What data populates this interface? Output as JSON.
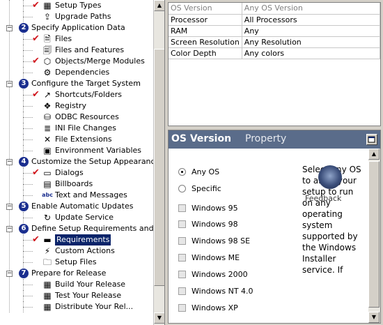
{
  "tree": {
    "items": [
      {
        "type": "leaf",
        "label": "Setup Types",
        "check": true,
        "icon": "setup-types-icon",
        "glyph": "▦"
      },
      {
        "type": "leaf",
        "label": "Upgrade Paths",
        "check": false,
        "icon": "upgrade-paths-icon",
        "glyph": "⇪"
      },
      {
        "type": "step",
        "num": "2",
        "label": "Specify Application Data"
      },
      {
        "type": "leaf",
        "label": "Files",
        "check": true,
        "icon": "files-icon",
        "glyph": "🗎"
      },
      {
        "type": "leaf",
        "label": "Files and Features",
        "check": false,
        "icon": "files-features-icon",
        "glyph": "🗐"
      },
      {
        "type": "leaf",
        "label": "Objects/Merge Modules",
        "check": true,
        "icon": "merge-modules-icon",
        "glyph": "⬡"
      },
      {
        "type": "leaf",
        "label": "Dependencies",
        "check": false,
        "icon": "dependencies-icon",
        "glyph": "⚙"
      },
      {
        "type": "step",
        "num": "3",
        "label": "Configure the Target System"
      },
      {
        "type": "leaf",
        "label": "Shortcuts/Folders",
        "check": true,
        "icon": "shortcuts-icon",
        "glyph": "↗"
      },
      {
        "type": "leaf",
        "label": "Registry",
        "check": false,
        "icon": "registry-icon",
        "glyph": "❖"
      },
      {
        "type": "leaf",
        "label": "ODBC Resources",
        "check": false,
        "icon": "odbc-icon",
        "glyph": "⛁"
      },
      {
        "type": "leaf",
        "label": "INI File Changes",
        "check": false,
        "icon": "ini-file-icon",
        "glyph": "≣"
      },
      {
        "type": "leaf",
        "label": "File Extensions",
        "check": false,
        "icon": "file-extensions-icon",
        "glyph": "✕"
      },
      {
        "type": "leaf",
        "label": "Environment Variables",
        "check": false,
        "icon": "environment-icon",
        "glyph": "▣"
      },
      {
        "type": "step",
        "num": "4",
        "label": "Customize the Setup Appearance"
      },
      {
        "type": "leaf",
        "label": "Dialogs",
        "check": true,
        "icon": "dialogs-icon",
        "glyph": "▭"
      },
      {
        "type": "leaf",
        "label": "Billboards",
        "check": false,
        "icon": "billboards-icon",
        "glyph": "▤"
      },
      {
        "type": "leaf",
        "label": "Text and Messages",
        "check": false,
        "icon": "text-messages-icon",
        "glyph": "abc"
      },
      {
        "type": "step",
        "num": "5",
        "label": "Enable Automatic Updates"
      },
      {
        "type": "leaf",
        "label": "Update Service",
        "check": false,
        "icon": "update-service-icon",
        "glyph": "↻"
      },
      {
        "type": "step",
        "num": "6",
        "label": "Define Setup Requirements and Acti"
      },
      {
        "type": "leaf",
        "label": "Requirements",
        "check": true,
        "icon": "requirements-icon",
        "glyph": "▬",
        "selected": true
      },
      {
        "type": "leaf",
        "label": "Custom Actions",
        "check": false,
        "icon": "custom-actions-icon",
        "glyph": "⚡"
      },
      {
        "type": "leaf",
        "label": "Setup Files",
        "check": false,
        "icon": "setup-files-icon",
        "glyph": "🗀"
      },
      {
        "type": "step",
        "num": "7",
        "label": "Prepare for Release"
      },
      {
        "type": "leaf",
        "label": "Build Your Release",
        "check": false,
        "icon": "build-release-icon",
        "glyph": "▦"
      },
      {
        "type": "leaf",
        "label": "Test Your Release",
        "check": false,
        "icon": "test-release-icon",
        "glyph": "▦"
      },
      {
        "type": "leaf",
        "label": "Distribute Your Rel...",
        "check": false,
        "icon": "distribute-release-icon",
        "glyph": "▦"
      }
    ]
  },
  "grid": {
    "header": [
      "OS Version",
      "Any OS Version"
    ],
    "rows": [
      [
        "Processor",
        "All Processors"
      ],
      [
        "RAM",
        "Any"
      ],
      [
        "Screen Resolution",
        "Any Resolution"
      ],
      [
        "Color Depth",
        "Any colors"
      ]
    ]
  },
  "prop": {
    "title": "OS Version",
    "subtitle": "Property",
    "radios": [
      {
        "label": "Any OS",
        "selected": true
      },
      {
        "label": "Specific",
        "selected": false
      }
    ],
    "checkboxes": [
      "Windows 95",
      "Windows 98",
      "Windows 98 SE",
      "Windows ME",
      "Windows 2000",
      "Windows NT 4.0",
      "Windows XP"
    ],
    "description": "Select Any OS to allow your setup to run on any operating system supported by the Windows Installer service. If",
    "feedback_label": "Feedback"
  }
}
